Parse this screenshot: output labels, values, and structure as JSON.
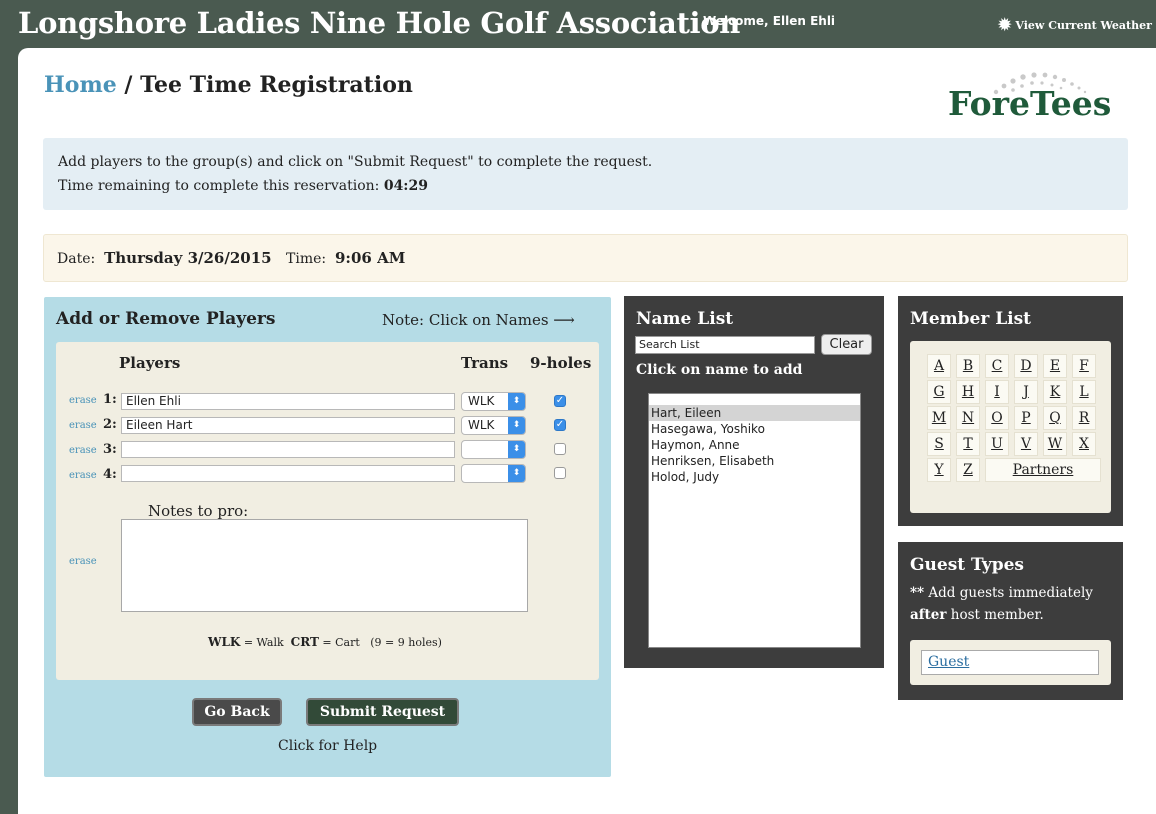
{
  "header": {
    "title": "Longshore Ladies Nine Hole Golf Association",
    "welcome": "Welcome, Ellen Ehli",
    "weather_label": "View Current Weather",
    "weather_icon": "sun-icon"
  },
  "breadcrumb": {
    "home": "Home",
    "separator": " / ",
    "current": "Tee Time Registration"
  },
  "logo": {
    "text": "ForeTees"
  },
  "info": {
    "line1": "Add players to the group(s) and click on \"Submit Request\" to complete the request.",
    "line2_label": "Time remaining to complete this reservation: ",
    "countdown": "04:29"
  },
  "reservation": {
    "date_label": "Date:",
    "date_value": "Thursday 3/26/2015",
    "time_label": "Time:",
    "time_value": "9:06 AM"
  },
  "players_panel": {
    "title": "Add or Remove Players",
    "note": "Note: Click on Names ⟶",
    "col_players": "Players",
    "col_trans": "Trans",
    "col_nine": "9-holes",
    "erase_label": "erase",
    "rows": [
      {
        "num": "1:",
        "name": "Ellen Ehli",
        "trans": "WLK",
        "nine": true
      },
      {
        "num": "2:",
        "name": "Eileen Hart",
        "trans": "WLK",
        "nine": true
      },
      {
        "num": "3:",
        "name": "",
        "trans": "",
        "nine": false
      },
      {
        "num": "4:",
        "name": "",
        "trans": "",
        "nine": false
      }
    ],
    "notes_label": "Notes to pro:",
    "notes_value": "",
    "legend_wlk": "WLK",
    "legend_wlk_text": " = Walk  ",
    "legend_crt": "CRT",
    "legend_crt_text": " = Cart   (9 = 9 holes)",
    "go_back": "Go Back",
    "submit": "Submit Request",
    "help": "Click for Help"
  },
  "name_list": {
    "title": "Name List",
    "search_value": "Search List",
    "clear": "Clear",
    "instruction": "Click on name to add",
    "names": [
      "Hart, Eileen",
      "Hasegawa, Yoshiko",
      "Haymon, Anne",
      "Henriksen, Elisabeth",
      "Holod, Judy"
    ],
    "selected_index": 0
  },
  "member_list": {
    "title": "Member List",
    "letters": [
      "A",
      "B",
      "C",
      "D",
      "E",
      "F",
      "G",
      "H",
      "I",
      "J",
      "K",
      "L",
      "M",
      "N",
      "O",
      "P",
      "Q",
      "R",
      "S",
      "T",
      "U",
      "V",
      "W",
      "X",
      "Y",
      "Z"
    ],
    "partners": "Partners"
  },
  "guest_types": {
    "title": "Guest Types",
    "note_stars": "**",
    "note_text": " Add guests immediately ",
    "note_after": "after",
    "note_end": " host member.",
    "guest_link": "Guest"
  }
}
